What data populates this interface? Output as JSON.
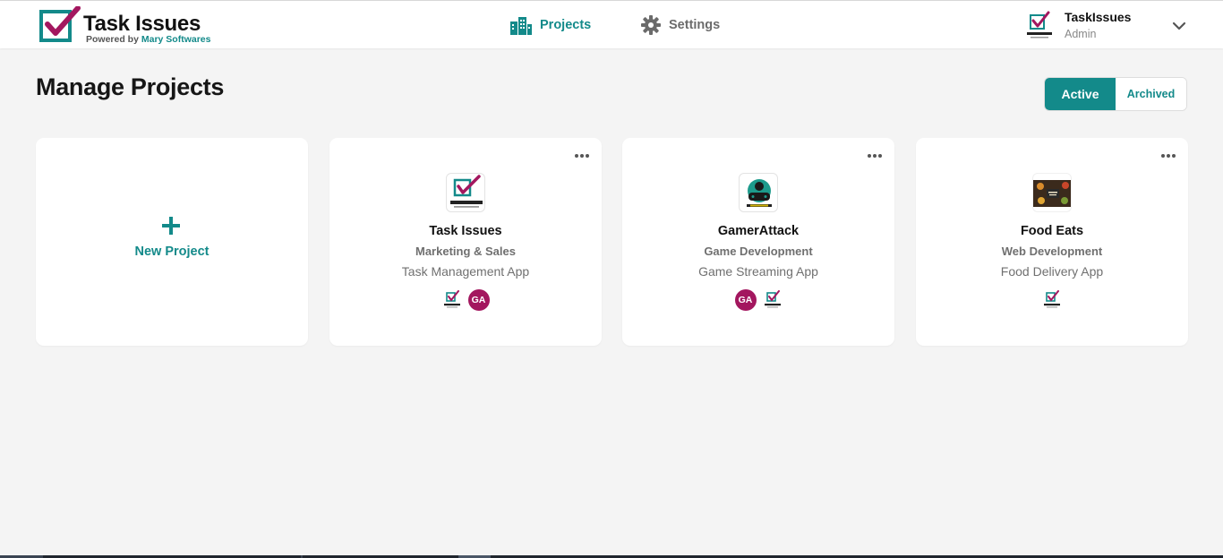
{
  "app": {
    "title": "Task Issues",
    "powered_prefix": "Powered by",
    "powered_brand": "Mary Softwares",
    "accent_color": "#138a8a",
    "brand_color": "#a3175f"
  },
  "nav": [
    {
      "label": "Projects",
      "icon": "buildings-icon",
      "active": true
    },
    {
      "label": "Settings",
      "icon": "gear-icon",
      "active": false
    }
  ],
  "user": {
    "name": "TaskIssues",
    "role": "Admin",
    "avatar_icon": "task-issues-logo-icon"
  },
  "page": {
    "title": "Manage Projects"
  },
  "filter": {
    "active_label": "Active",
    "archived_label": "Archived",
    "selected": "Active"
  },
  "new_project": {
    "label": "New Project",
    "icon": "plus-icon"
  },
  "projects": [
    {
      "name": "Task Issues",
      "category": "Marketing & Sales",
      "description": "Task Management App",
      "icon": "task-issues-logo-icon",
      "members": [
        {
          "type": "logo",
          "icon": "task-issues-logo-icon"
        },
        {
          "type": "initials",
          "text": "GA"
        }
      ]
    },
    {
      "name": "GamerAttack",
      "category": "Game Development",
      "description": "Game Streaming App",
      "icon": "gamepad-logo-icon",
      "members": [
        {
          "type": "initials",
          "text": "GA"
        },
        {
          "type": "logo",
          "icon": "task-issues-logo-icon"
        }
      ]
    },
    {
      "name": "Food Eats",
      "category": "Web Development",
      "description": "Food Delivery App",
      "icon": "food-photo-icon",
      "members": [
        {
          "type": "logo",
          "icon": "task-issues-logo-icon"
        }
      ]
    }
  ]
}
